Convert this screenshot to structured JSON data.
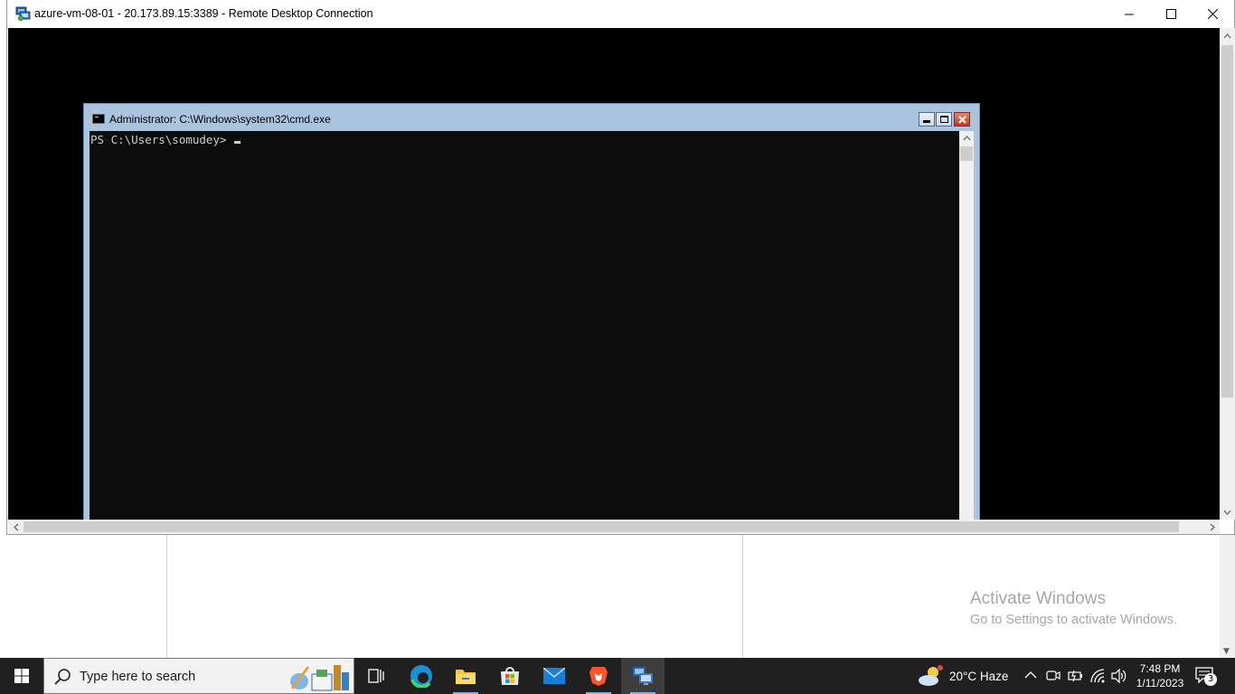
{
  "rdp_window": {
    "title": "azure-vm-08-01 - 20.173.89.15:3389 - Remote Desktop Connection"
  },
  "cmd_window": {
    "title": "Administrator: C:\\Windows\\system32\\cmd.exe",
    "prompt": "PS C:\\Users\\somudey>"
  },
  "watermark": {
    "line1": "Activate Windows",
    "line2": "Go to Settings to activate Windows."
  },
  "taskbar": {
    "search_placeholder": "Type here to search",
    "weather": "20°C  Haze",
    "time": "7:48 PM",
    "date": "1/11/2023",
    "notification_count": "3",
    "apps": [
      "task-view",
      "edge",
      "file-explorer",
      "microsoft-store",
      "mail",
      "brave",
      "remote-desktop"
    ]
  },
  "colors": {
    "taskbar_bg": "#202020",
    "console_bg": "#0c0c0c",
    "console_fg": "#cccccc",
    "cmd_frame": "#abc4de",
    "active_indicator": "#76b9ed"
  }
}
